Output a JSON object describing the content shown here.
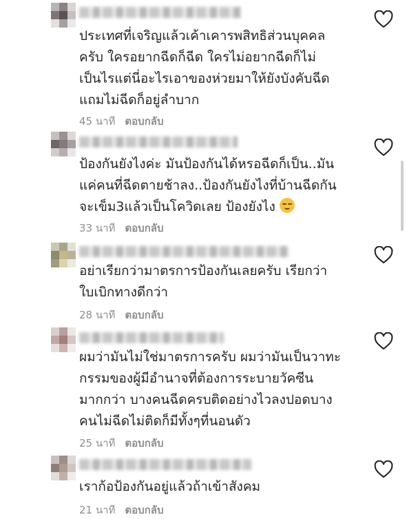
{
  "comments": [
    {
      "text": "ประเทศที่เจริญแล้วเค้าเคารพสิทธิส่วนบุคคล\nครับ ใครอยากฉีดก็ฉีด ใครไม่อยากฉีดก็ไม่\nเป็นไรแต่นี่อะไรเอาของห่วยมาให้ยังบังคับฉีด\nแถมไม่ฉีดก็อยู่ลำบาก",
      "time": "45 นาที",
      "reply": "ตอบกลับ"
    },
    {
      "text": "ป้องกันยังไงค่ะ มันป้องกันได้หรอฉีดก็เป็น..มัน\nแค่คนที่ฉีดตายช้าลง..ป้องกันยังไงที่บ้านฉีดกัน\nจะเข็ม3แล้วเป็นโควิดเลย ป้องยังไง",
      "emoji": "smirking-face",
      "time": "33 นาที",
      "reply": "ตอบกลับ"
    },
    {
      "text": "อย่าเรียกว่ามาตรการป้องกันเลยครับ เรียกว่า\nใบเบิกทางดีกว่า",
      "time": "28 นาที",
      "reply": "ตอบกลับ"
    },
    {
      "text": "ผมว่ามันไม่ใช่มาตรการครับ ผมว่ามันเป็นวาทะ\nกรรมของผู้มีอำนาจที่ต้องการระบายวัคซีน\nมากกว่า บางคนฉีดครบติดอย่างไวลงปอดบาง\nคนไม่ฉีดไม่ติดก็มีทั้งๆที่นอนดัว",
      "time": "25 นาที",
      "reply": "ตอบกลับ"
    },
    {
      "text": "เราก้อป้องกันอยู่แล้วถ้าเข้าสังคม",
      "time": "21 นาที",
      "reply": "ตอบกลับ"
    }
  ],
  "icons": {
    "like": "heart-outline-icon"
  },
  "colors": {
    "text": "#262626",
    "meta": "#8e8e8e",
    "background": "#ffffff"
  }
}
